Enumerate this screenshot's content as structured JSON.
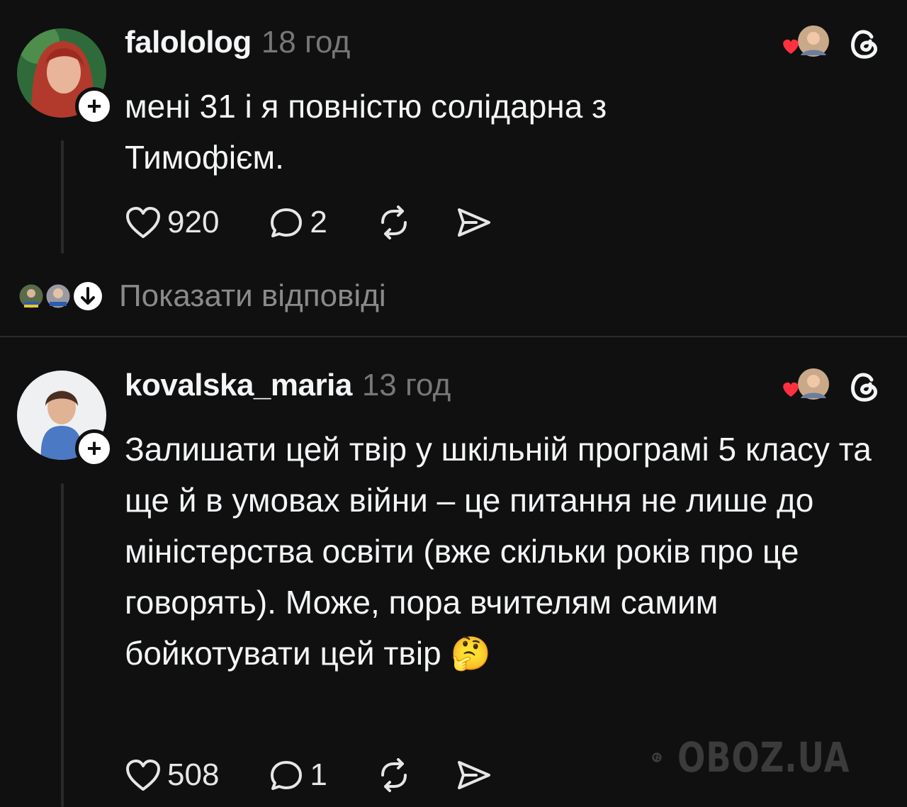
{
  "posts": [
    {
      "username": "falololog",
      "time": "18 год",
      "text": "мені 31 і я повністю солідарна з Тимофієм.",
      "likes": "920",
      "replies": "2",
      "show_replies": "Показати відповіді"
    },
    {
      "username": "kovalska_maria",
      "time": "13 год",
      "text": "Залишати цей твір у шкільній програмі 5 класу та ще й в умовах війни – це питання не лише до міністерства освіти (вже скільки років про це говорять). Може, пора вчителям самим бойкотувати цей твір 🤔",
      "likes": "508",
      "replies": "1"
    }
  ],
  "icons": {
    "like": "heart-icon",
    "reply": "comment-icon",
    "repost": "repost-icon",
    "share": "share-icon",
    "threads": "threads-logo-icon",
    "plus": "plus-icon",
    "show_replies": "arrow-down-icon"
  },
  "watermark": {
    "text": "OBOZ.UA"
  },
  "colors": {
    "background": "#101010",
    "text": "#f3f5f7",
    "muted": "#777777",
    "heart": "#ff3040"
  }
}
